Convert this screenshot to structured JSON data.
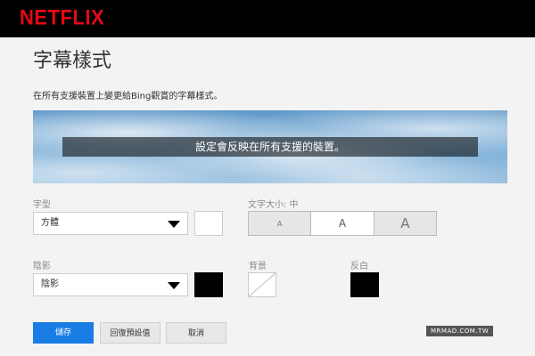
{
  "header": {
    "logo": "NETFLIX"
  },
  "page": {
    "title": "字幕樣式",
    "subtitle": "在所有支援裝置上變更給Bing觀賞的字幕樣式。"
  },
  "preview": {
    "caption": "設定會反映在所有支援的裝置。"
  },
  "font": {
    "label": "字型",
    "value": "方體",
    "color": "#ffffff"
  },
  "text_size": {
    "label": "文字大小: 中",
    "options": [
      "A",
      "A",
      "A"
    ],
    "selected_index": 1
  },
  "shadow": {
    "label": "陰影",
    "value": "陰影",
    "color": "#000000"
  },
  "background": {
    "label": "背景",
    "color": "none"
  },
  "window": {
    "label": "反白",
    "color": "#000000"
  },
  "actions": {
    "save": "儲存",
    "reset": "回復預設值",
    "cancel": "取消"
  },
  "watermark": "MRMAD.COM.TW",
  "colors": {
    "brand": "#e50914",
    "accent": "#1a7de6"
  }
}
